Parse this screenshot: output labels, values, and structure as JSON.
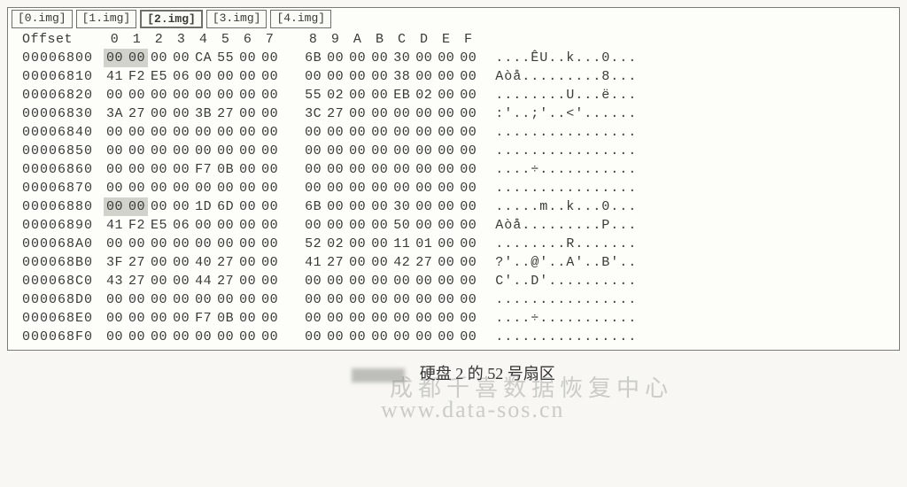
{
  "tabs": [
    {
      "label": "[0.img]",
      "active": false
    },
    {
      "label": "[1.img]",
      "active": false
    },
    {
      "label": "[2.img]",
      "active": true
    },
    {
      "label": "[3.img]",
      "active": false
    },
    {
      "label": "[4.img]",
      "active": false
    }
  ],
  "header": {
    "offset_label": "Offset",
    "cols": [
      "0",
      "1",
      "2",
      "3",
      "4",
      "5",
      "6",
      "7",
      "8",
      "9",
      "A",
      "B",
      "C",
      "D",
      "E",
      "F"
    ]
  },
  "rows": [
    {
      "offset": "00006800",
      "hex": [
        "00",
        "00",
        "00",
        "00",
        "CA",
        "55",
        "00",
        "00",
        "6B",
        "00",
        "00",
        "00",
        "30",
        "00",
        "00",
        "00"
      ],
      "ascii": "....ÊU..k...0...",
      "hl": [
        0,
        1
      ]
    },
    {
      "offset": "00006810",
      "hex": [
        "41",
        "F2",
        "E5",
        "06",
        "00",
        "00",
        "00",
        "00",
        "00",
        "00",
        "00",
        "00",
        "38",
        "00",
        "00",
        "00"
      ],
      "ascii": "Aòå.........8..."
    },
    {
      "offset": "00006820",
      "hex": [
        "00",
        "00",
        "00",
        "00",
        "00",
        "00",
        "00",
        "00",
        "55",
        "02",
        "00",
        "00",
        "EB",
        "02",
        "00",
        "00"
      ],
      "ascii": "........U...ë..."
    },
    {
      "offset": "00006830",
      "hex": [
        "3A",
        "27",
        "00",
        "00",
        "3B",
        "27",
        "00",
        "00",
        "3C",
        "27",
        "00",
        "00",
        "00",
        "00",
        "00",
        "00"
      ],
      "ascii": ":'..;'..<'......"
    },
    {
      "offset": "00006840",
      "hex": [
        "00",
        "00",
        "00",
        "00",
        "00",
        "00",
        "00",
        "00",
        "00",
        "00",
        "00",
        "00",
        "00",
        "00",
        "00",
        "00"
      ],
      "ascii": "................"
    },
    {
      "offset": "00006850",
      "hex": [
        "00",
        "00",
        "00",
        "00",
        "00",
        "00",
        "00",
        "00",
        "00",
        "00",
        "00",
        "00",
        "00",
        "00",
        "00",
        "00"
      ],
      "ascii": "................"
    },
    {
      "offset": "00006860",
      "hex": [
        "00",
        "00",
        "00",
        "00",
        "F7",
        "0B",
        "00",
        "00",
        "00",
        "00",
        "00",
        "00",
        "00",
        "00",
        "00",
        "00"
      ],
      "ascii": "....÷..........."
    },
    {
      "offset": "00006870",
      "hex": [
        "00",
        "00",
        "00",
        "00",
        "00",
        "00",
        "00",
        "00",
        "00",
        "00",
        "00",
        "00",
        "00",
        "00",
        "00",
        "00"
      ],
      "ascii": "................"
    },
    {
      "offset": "00006880",
      "hex": [
        "00",
        "00",
        "00",
        "00",
        "1D",
        "6D",
        "00",
        "00",
        "6B",
        "00",
        "00",
        "00",
        "30",
        "00",
        "00",
        "00"
      ],
      "ascii": ".....m..k...0...",
      "hl": [
        0,
        1
      ]
    },
    {
      "offset": "00006890",
      "hex": [
        "41",
        "F2",
        "E5",
        "06",
        "00",
        "00",
        "00",
        "00",
        "00",
        "00",
        "00",
        "00",
        "50",
        "00",
        "00",
        "00"
      ],
      "ascii": "Aòå.........P..."
    },
    {
      "offset": "000068A0",
      "hex": [
        "00",
        "00",
        "00",
        "00",
        "00",
        "00",
        "00",
        "00",
        "52",
        "02",
        "00",
        "00",
        "11",
        "01",
        "00",
        "00"
      ],
      "ascii": "........R......."
    },
    {
      "offset": "000068B0",
      "hex": [
        "3F",
        "27",
        "00",
        "00",
        "40",
        "27",
        "00",
        "00",
        "41",
        "27",
        "00",
        "00",
        "42",
        "27",
        "00",
        "00"
      ],
      "ascii": "?'..@'..A'..B'.."
    },
    {
      "offset": "000068C0",
      "hex": [
        "43",
        "27",
        "00",
        "00",
        "44",
        "27",
        "00",
        "00",
        "00",
        "00",
        "00",
        "00",
        "00",
        "00",
        "00",
        "00"
      ],
      "ascii": "C'..D'.........."
    },
    {
      "offset": "000068D0",
      "hex": [
        "00",
        "00",
        "00",
        "00",
        "00",
        "00",
        "00",
        "00",
        "00",
        "00",
        "00",
        "00",
        "00",
        "00",
        "00",
        "00"
      ],
      "ascii": "................"
    },
    {
      "offset": "000068E0",
      "hex": [
        "00",
        "00",
        "00",
        "00",
        "F7",
        "0B",
        "00",
        "00",
        "00",
        "00",
        "00",
        "00",
        "00",
        "00",
        "00",
        "00"
      ],
      "ascii": "....÷..........."
    },
    {
      "offset": "000068F0",
      "hex": [
        "00",
        "00",
        "00",
        "00",
        "00",
        "00",
        "00",
        "00",
        "00",
        "00",
        "00",
        "00",
        "00",
        "00",
        "00",
        "00"
      ],
      "ascii": "................"
    }
  ],
  "caption": "硬盘 2 的 52 号扇区",
  "watermark1": "成都千喜数据恢复中心",
  "watermark2": "www.data-sos.cn"
}
